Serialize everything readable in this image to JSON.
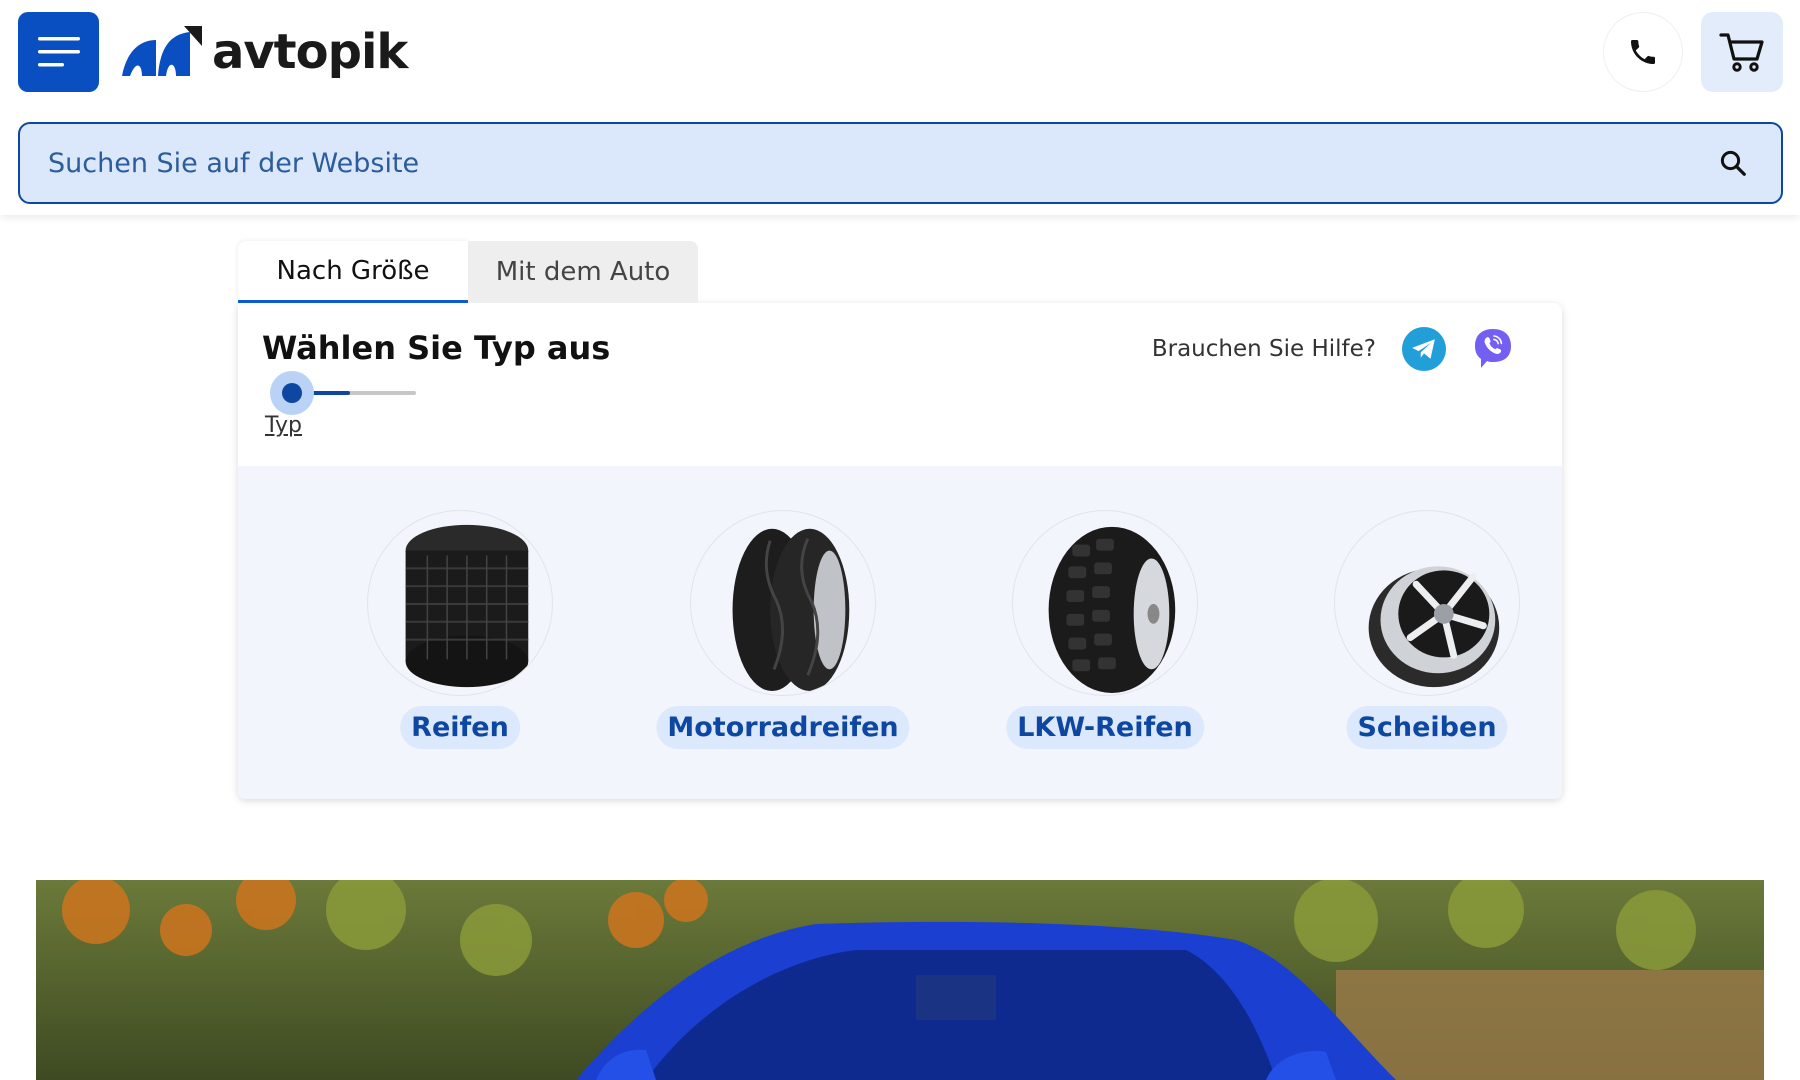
{
  "header": {
    "logo_text": "avtopik",
    "search_placeholder": "Suchen Sie auf der Website"
  },
  "tabs": [
    {
      "label": "Nach Größe",
      "active": true
    },
    {
      "label": "Mit dem Auto",
      "active": false
    }
  ],
  "panel": {
    "title": "Wählen Sie Typ aus",
    "step_label": "Typ",
    "help_text": "Brauchen Sie Hilfe?"
  },
  "types": [
    {
      "label": "Reifen",
      "icon": "tire-stack-image"
    },
    {
      "label": "Motorradreifen",
      "icon": "motorcycle-tires-image"
    },
    {
      "label": "LKW-Reifen",
      "icon": "truck-tire-image"
    },
    {
      "label": "Scheiben",
      "icon": "wheel-rim-image"
    }
  ],
  "colors": {
    "brand": "#0a4fc2",
    "accent": "#0d47a1",
    "search_bg": "#dbe7fa",
    "telegram": "#229ed9",
    "viber": "#7360f2"
  }
}
